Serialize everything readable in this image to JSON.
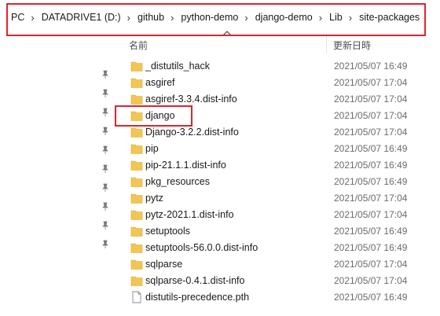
{
  "breadcrumb": [
    "PC",
    "DATADRIVE1 (D:)",
    "github",
    "python-demo",
    "django-demo",
    "Lib",
    "site-packages"
  ],
  "columns": {
    "name": "名前",
    "date": "更新日時"
  },
  "files": [
    {
      "name": "_distutils_hack",
      "date": "2021/05/07 16:49",
      "type": "folder"
    },
    {
      "name": "asgiref",
      "date": "2021/05/07 17:04",
      "type": "folder"
    },
    {
      "name": "asgiref-3.3.4.dist-info",
      "date": "2021/05/07 17:04",
      "type": "folder"
    },
    {
      "name": "django",
      "date": "2021/05/07 17:04",
      "type": "folder"
    },
    {
      "name": "Django-3.2.2.dist-info",
      "date": "2021/05/07 17:04",
      "type": "folder"
    },
    {
      "name": "pip",
      "date": "2021/05/07 16:49",
      "type": "folder"
    },
    {
      "name": "pip-21.1.1.dist-info",
      "date": "2021/05/07 16:49",
      "type": "folder"
    },
    {
      "name": "pkg_resources",
      "date": "2021/05/07 16:49",
      "type": "folder"
    },
    {
      "name": "pytz",
      "date": "2021/05/07 17:04",
      "type": "folder"
    },
    {
      "name": "pytz-2021.1.dist-info",
      "date": "2021/05/07 17:04",
      "type": "folder"
    },
    {
      "name": "setuptools",
      "date": "2021/05/07 16:49",
      "type": "folder"
    },
    {
      "name": "setuptools-56.0.0.dist-info",
      "date": "2021/05/07 16:49",
      "type": "folder"
    },
    {
      "name": "sqlparse",
      "date": "2021/05/07 17:04",
      "type": "folder"
    },
    {
      "name": "sqlparse-0.4.1.dist-info",
      "date": "2021/05/07 17:04",
      "type": "folder"
    },
    {
      "name": "distutils-precedence.pth",
      "date": "2021/05/07 16:49",
      "type": "file"
    }
  ],
  "colors": {
    "highlight": "#e0242b",
    "folder": "#f4c552"
  }
}
